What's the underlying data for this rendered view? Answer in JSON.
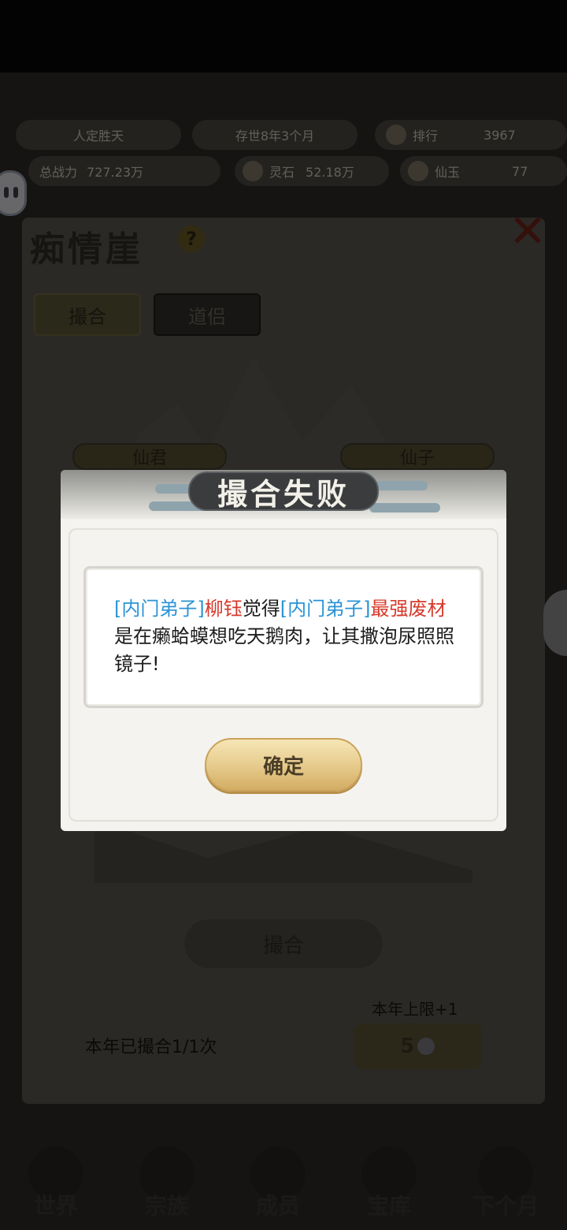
{
  "status_bar": {
    "realm": "人定胜天",
    "age": "存世8年3个月",
    "rank_label": "排行",
    "rank_value": "3967",
    "power_label": "总战力",
    "power_value": "727.23万",
    "lingshi_label": "灵石",
    "lingshi_value": "52.18万",
    "xianyu_label": "仙玉",
    "xianyu_value": "77"
  },
  "panel": {
    "title": "痴情崖",
    "help_icon": "?",
    "close_icon": "✕",
    "tabs": [
      {
        "label": "撮合",
        "active": true
      },
      {
        "label": "道侣",
        "active": false
      }
    ],
    "left_name": "仙君",
    "right_name": "仙子",
    "match_button": "撮合",
    "limit_text": "本年上限+1",
    "count_text": "本年已撮合1/1次",
    "cost_value": "5",
    "cost_icon": "spirit-stone-icon"
  },
  "bottom_nav": [
    {
      "label": "世界",
      "icon": "world-icon"
    },
    {
      "label": "宗族",
      "icon": "clan-icon"
    },
    {
      "label": "成员",
      "icon": "members-icon"
    },
    {
      "label": "宝库",
      "icon": "treasury-icon"
    },
    {
      "label": "下个月",
      "icon": "next-month-icon"
    }
  ],
  "dialog": {
    "title": "撮合失败",
    "message": {
      "tag1": "[内门弟子]",
      "name1": "柳钰",
      "mid": "觉得",
      "tag2": "[内门弟子]",
      "name2": "最强废材",
      "rest": "是在癞蛤蟆想吃天鹅肉，让其撒泡尿照照镜子!"
    },
    "confirm_label": "确定"
  },
  "colors": {
    "tag_blue": "#2a93d6",
    "name_red": "#d63a2b",
    "button_gold": "#e5c98a"
  }
}
